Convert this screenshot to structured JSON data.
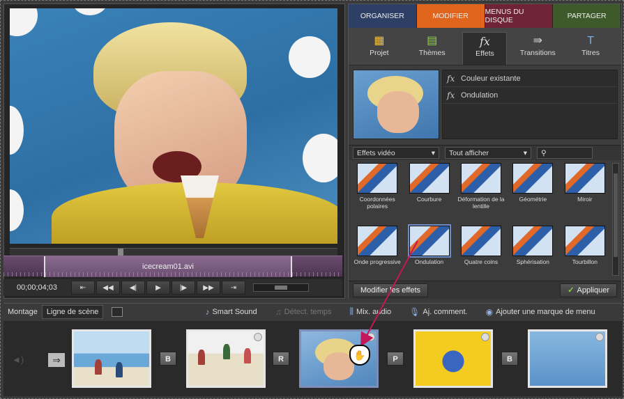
{
  "tabs": [
    "ORGANISER",
    "MODIFIER",
    "MENUS DU DISQUE",
    "PARTAGER"
  ],
  "tools": [
    {
      "label": "Projet",
      "icon": "folder-icon"
    },
    {
      "label": "Thèmes",
      "icon": "themes-icon"
    },
    {
      "label": "Effets",
      "icon": "fx-icon"
    },
    {
      "label": "Transitions",
      "icon": "transitions-icon"
    },
    {
      "label": "Titres",
      "icon": "titles-icon"
    }
  ],
  "applied_effects": [
    "Couleur existante",
    "Ondulation"
  ],
  "filters": {
    "category": "Effets vidéo",
    "show": "Tout afficher"
  },
  "effects_grid": [
    "Coordonnées polaires",
    "Courbure",
    "Déformation de la lentille",
    "Géométrie",
    "Miroir",
    "Onde progressive",
    "Ondulation",
    "Quatre coins",
    "Sphérisation",
    "Tourbillon"
  ],
  "buttons": {
    "edit_effects": "Modifier les effets",
    "apply": "Appliquer"
  },
  "monitor": {
    "clip_name": "icecream01.avi",
    "timecode": "00;00;04;03"
  },
  "timeline_bar": {
    "montage": "Montage",
    "scene_line": "Ligne de scène",
    "smart_sound": "Smart Sound",
    "detect_tempo": "Détect. temps",
    "audio_mix": "Mix. audio",
    "add_comment": "Aj. comment.",
    "add_menu_marker": "Ajouter une marque de menu"
  },
  "transitions": [
    "B",
    "R",
    "P",
    "B"
  ],
  "colors": {
    "tab_modifier": "#e0641b",
    "tab_organiser": "#2e3f66",
    "tab_menus": "#6e2435",
    "tab_partager": "#3e5a2a",
    "selection": "#6d8cc8"
  }
}
